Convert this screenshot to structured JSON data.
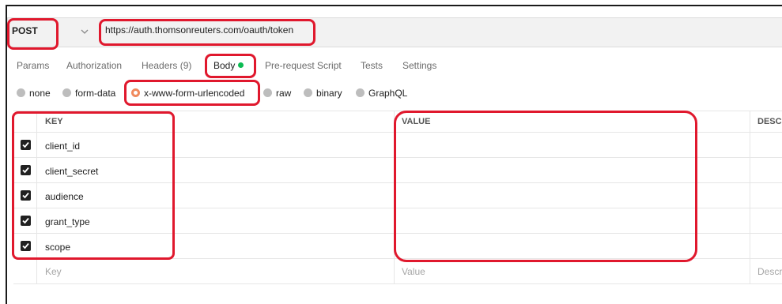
{
  "request": {
    "method": "POST",
    "url": "https://auth.thomsonreuters.com/oauth/token",
    "method_dropdown_icon": "chevron-down-icon"
  },
  "tabs": [
    {
      "label": "Params"
    },
    {
      "label": "Authorization"
    },
    {
      "label": "Headers (9)"
    },
    {
      "label": "Body",
      "active": true
    },
    {
      "label": "Pre-request Script"
    },
    {
      "label": "Tests"
    },
    {
      "label": "Settings"
    }
  ],
  "body_types": [
    {
      "label": "none"
    },
    {
      "label": "form-data"
    },
    {
      "label": "x-www-form-urlencoded",
      "selected": true
    },
    {
      "label": "raw"
    },
    {
      "label": "binary"
    },
    {
      "label": "GraphQL"
    }
  ],
  "table": {
    "headers": {
      "key": "KEY",
      "value": "VALUE",
      "description": "DESC"
    },
    "rows": [
      {
        "key": "client_id",
        "checked": true
      },
      {
        "key": "client_secret",
        "checked": true
      },
      {
        "key": "audience",
        "checked": true
      },
      {
        "key": "grant_type",
        "checked": true
      },
      {
        "key": "scope",
        "checked": true
      }
    ],
    "new_row": {
      "key_placeholder": "Key",
      "value_placeholder": "Value",
      "description_placeholder": "Descr"
    }
  },
  "colors": {
    "annotation": "#e0182d",
    "body_dot": "#0cbb52",
    "radio_selected": "#f08a5d"
  }
}
